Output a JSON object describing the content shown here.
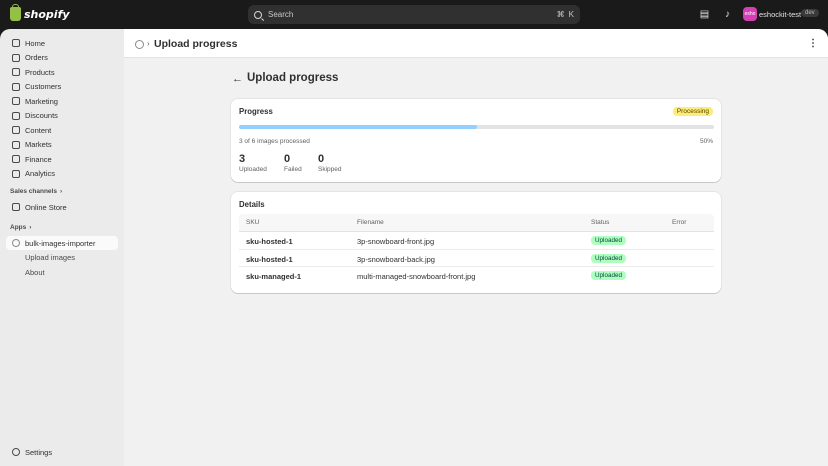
{
  "topbar": {
    "logo_text": "shopify",
    "search_placeholder": "Search",
    "shortcut_cmd": "⌘",
    "shortcut_key": "K",
    "store_avatar_text": "esho",
    "store_name": "eshockit-test",
    "env_badge": "dev"
  },
  "sidebar": {
    "nav": [
      {
        "label": "Home"
      },
      {
        "label": "Orders"
      },
      {
        "label": "Products"
      },
      {
        "label": "Customers"
      },
      {
        "label": "Marketing"
      },
      {
        "label": "Discounts"
      },
      {
        "label": "Content"
      },
      {
        "label": "Markets"
      },
      {
        "label": "Finance"
      },
      {
        "label": "Analytics"
      }
    ],
    "sales_channels_label": "Sales channels",
    "online_store": "Online Store",
    "apps_label": "Apps",
    "app_name": "bulk-images-importer",
    "app_sub": [
      "Upload images",
      "About"
    ],
    "settings": "Settings"
  },
  "header": {
    "title": "Upload progress",
    "more_icon": "ellipsis-icon"
  },
  "page": {
    "title": "Upload progress"
  },
  "progress_card": {
    "title": "Progress",
    "status_badge": "Processing",
    "progress_fraction": 0.5,
    "processed_text": "3 of 6 images processed",
    "percent_text": "50%",
    "stats": [
      {
        "value": "3",
        "label": "Uploaded"
      },
      {
        "value": "0",
        "label": "Failed"
      },
      {
        "value": "0",
        "label": "Skipped"
      }
    ]
  },
  "details_card": {
    "title": "Details",
    "columns": [
      "SKU",
      "Filename",
      "Status",
      "Error"
    ],
    "rows": [
      {
        "sku": "sku-hosted-1",
        "filename": "3p-snowboard-front.jpg",
        "status": "Uploaded",
        "error": ""
      },
      {
        "sku": "sku-hosted-1",
        "filename": "3p-snowboard-back.jpg",
        "status": "Uploaded",
        "error": ""
      },
      {
        "sku": "sku-managed-1",
        "filename": "multi-managed-snowboard-front.jpg",
        "status": "Uploaded",
        "error": ""
      }
    ]
  },
  "colors": {
    "progress_fill": "#91d0ff",
    "processing_badge": "#ffeb78",
    "uploaded_badge": "#affebf"
  }
}
